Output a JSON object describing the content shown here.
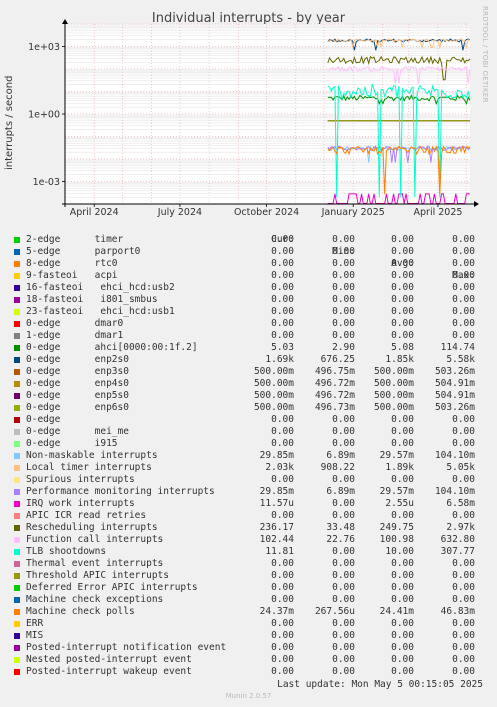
{
  "title": "Individual interrupts - by year",
  "rrd_label": "RRDTOOL / TOBI OETIKER",
  "munin_version": "Munin 2.0.57",
  "last_update": "Last update: Mon May  5 00:15:05 2025",
  "legend_headers": [
    "Cur:",
    "Min:",
    "Avg:",
    "Max:"
  ],
  "chart_data": {
    "type": "line",
    "title": "Individual interrupts - by year",
    "ylabel": "interrupts / second",
    "yscale": "log",
    "ylim": [
      0.0001,
      10000
    ],
    "y_ticks": [
      "1e+03",
      "1e+00",
      "1e-03"
    ],
    "x_ticks": [
      "April 2024",
      "July 2024",
      "October 2024",
      "January 2025",
      "April 2025"
    ],
    "xlim": [
      "2024-03-01",
      "2025-05-05"
    ],
    "data_start": "2024-12-05",
    "grid": true,
    "series": [
      {
        "name": "2-edge      timer",
        "color": "#00cc00",
        "cur": "0.00",
        "min": "0.00",
        "avg": "0.00",
        "max": "0.00"
      },
      {
        "name": "5-edge      parport0",
        "color": "#0066b3",
        "cur": "0.00",
        "min": "0.00",
        "avg": "0.00",
        "max": "0.00"
      },
      {
        "name": "8-edge      rtc0",
        "color": "#ff8000",
        "cur": "0.00",
        "min": "0.00",
        "avg": "0.00",
        "max": "0.00"
      },
      {
        "name": "9-fasteoi   acpi",
        "color": "#ffcc00",
        "cur": "0.00",
        "min": "0.00",
        "avg": "0.00",
        "max": "0.00"
      },
      {
        "name": "16-fasteoi   ehci_hcd:usb2",
        "color": "#330099",
        "cur": "0.00",
        "min": "0.00",
        "avg": "0.00",
        "max": "0.00"
      },
      {
        "name": "18-fasteoi   i801_smbus",
        "color": "#990099",
        "cur": "0.00",
        "min": "0.00",
        "avg": "0.00",
        "max": "0.00"
      },
      {
        "name": "23-fasteoi   ehci_hcd:usb1",
        "color": "#ccff00",
        "cur": "0.00",
        "min": "0.00",
        "avg": "0.00",
        "max": "0.00"
      },
      {
        "name": "0-edge      dmar0",
        "color": "#ff0000",
        "cur": "0.00",
        "min": "0.00",
        "avg": "0.00",
        "max": "0.00"
      },
      {
        "name": "1-edge      dmar1",
        "color": "#808080",
        "cur": "0.00",
        "min": "0.00",
        "avg": "0.00",
        "max": "0.00"
      },
      {
        "name": "0-edge      ahci[0000:00:1f.2]",
        "color": "#008f00",
        "cur": "5.03",
        "min": "2.90",
        "avg": "5.08",
        "max": "114.74"
      },
      {
        "name": "0-edge      enp2s0",
        "color": "#00487d",
        "cur": "1.69k",
        "min": "676.25",
        "avg": "1.85k",
        "max": "5.58k"
      },
      {
        "name": "0-edge      enp3s0",
        "color": "#b35a00",
        "cur": "500.00m",
        "min": "496.75m",
        "avg": "500.00m",
        "max": "503.26m"
      },
      {
        "name": "0-edge      enp4s0",
        "color": "#b38f00",
        "cur": "500.00m",
        "min": "496.72m",
        "avg": "500.00m",
        "max": "504.91m"
      },
      {
        "name": "0-edge      enp5s0",
        "color": "#6b006b",
        "cur": "500.00m",
        "min": "496.72m",
        "avg": "500.00m",
        "max": "504.91m"
      },
      {
        "name": "0-edge      enp6s0",
        "color": "#8fb300",
        "cur": "500.00m",
        "min": "496.73m",
        "avg": "500.00m",
        "max": "503.26m"
      },
      {
        "name": "0-edge",
        "color": "#b30000",
        "cur": "0.00",
        "min": "0.00",
        "avg": "0.00",
        "max": "0.00"
      },
      {
        "name": "0-edge      mei_me",
        "color": "#bebebe",
        "cur": "0.00",
        "min": "0.00",
        "avg": "0.00",
        "max": "0.00"
      },
      {
        "name": "0-edge      i915",
        "color": "#80ff80",
        "cur": "0.00",
        "min": "0.00",
        "avg": "0.00",
        "max": "0.00"
      },
      {
        "name": "Non-maskable interrupts",
        "color": "#80c9ff",
        "cur": "29.85m",
        "min": "6.89m",
        "avg": "29.57m",
        "max": "104.10m"
      },
      {
        "name": "Local timer interrupts",
        "color": "#ffc080",
        "cur": "2.03k",
        "min": "908.22",
        "avg": "1.89k",
        "max": "5.05k"
      },
      {
        "name": "Spurious interrupts",
        "color": "#ffe680",
        "cur": "0.00",
        "min": "0.00",
        "avg": "0.00",
        "max": "0.00"
      },
      {
        "name": "Performance monitoring interrupts",
        "color": "#aa80ff",
        "cur": "29.85m",
        "min": "6.89m",
        "avg": "29.57m",
        "max": "104.10m"
      },
      {
        "name": "IRQ work interrupts",
        "color": "#ee00cc",
        "cur": "11.57u",
        "min": "0.00",
        "avg": "2.55u",
        "max": "6.58m"
      },
      {
        "name": "APIC ICR read retries",
        "color": "#ff8080",
        "cur": "0.00",
        "min": "0.00",
        "avg": "0.00",
        "max": "0.00"
      },
      {
        "name": "Rescheduling interrupts",
        "color": "#666600",
        "cur": "236.17",
        "min": "33.48",
        "avg": "249.75",
        "max": "2.97k"
      },
      {
        "name": "Function call interrupts",
        "color": "#ffbfff",
        "cur": "102.44",
        "min": "22.76",
        "avg": "100.98",
        "max": "632.80"
      },
      {
        "name": "TLB shootdowns",
        "color": "#00ffcc",
        "cur": "11.81",
        "min": "0.00",
        "avg": "10.00",
        "max": "307.77"
      },
      {
        "name": "Thermal event interrupts",
        "color": "#cc6699",
        "cur": "0.00",
        "min": "0.00",
        "avg": "0.00",
        "max": "0.00"
      },
      {
        "name": "Threshold APIC interrupts",
        "color": "#999900",
        "cur": "0.00",
        "min": "0.00",
        "avg": "0.00",
        "max": "0.00"
      },
      {
        "name": "Deferred Error APIC interrupts",
        "color": "#00cc00",
        "cur": "0.00",
        "min": "0.00",
        "avg": "0.00",
        "max": "0.00"
      },
      {
        "name": "Machine check exceptions",
        "color": "#0066b3",
        "cur": "0.00",
        "min": "0.00",
        "avg": "0.00",
        "max": "0.00"
      },
      {
        "name": "Machine check polls",
        "color": "#ff8000",
        "cur": "24.37m",
        "min": "267.56u",
        "avg": "24.41m",
        "max": "46.83m"
      },
      {
        "name": "ERR",
        "color": "#ffcc00",
        "cur": "0.00",
        "min": "0.00",
        "avg": "0.00",
        "max": "0.00"
      },
      {
        "name": "MIS",
        "color": "#330099",
        "cur": "0.00",
        "min": "0.00",
        "avg": "0.00",
        "max": "0.00"
      },
      {
        "name": "Posted-interrupt notification event",
        "color": "#990099",
        "cur": "0.00",
        "min": "0.00",
        "avg": "0.00",
        "max": "0.00"
      },
      {
        "name": "Nested posted-interrupt event",
        "color": "#ccff00",
        "cur": "0.00",
        "min": "0.00",
        "avg": "0.00",
        "max": "0.00"
      },
      {
        "name": "Posted-interrupt wakeup event",
        "color": "#ff0000",
        "cur": "0.00",
        "min": "0.00",
        "avg": "0.00",
        "max": "0.00"
      }
    ]
  }
}
